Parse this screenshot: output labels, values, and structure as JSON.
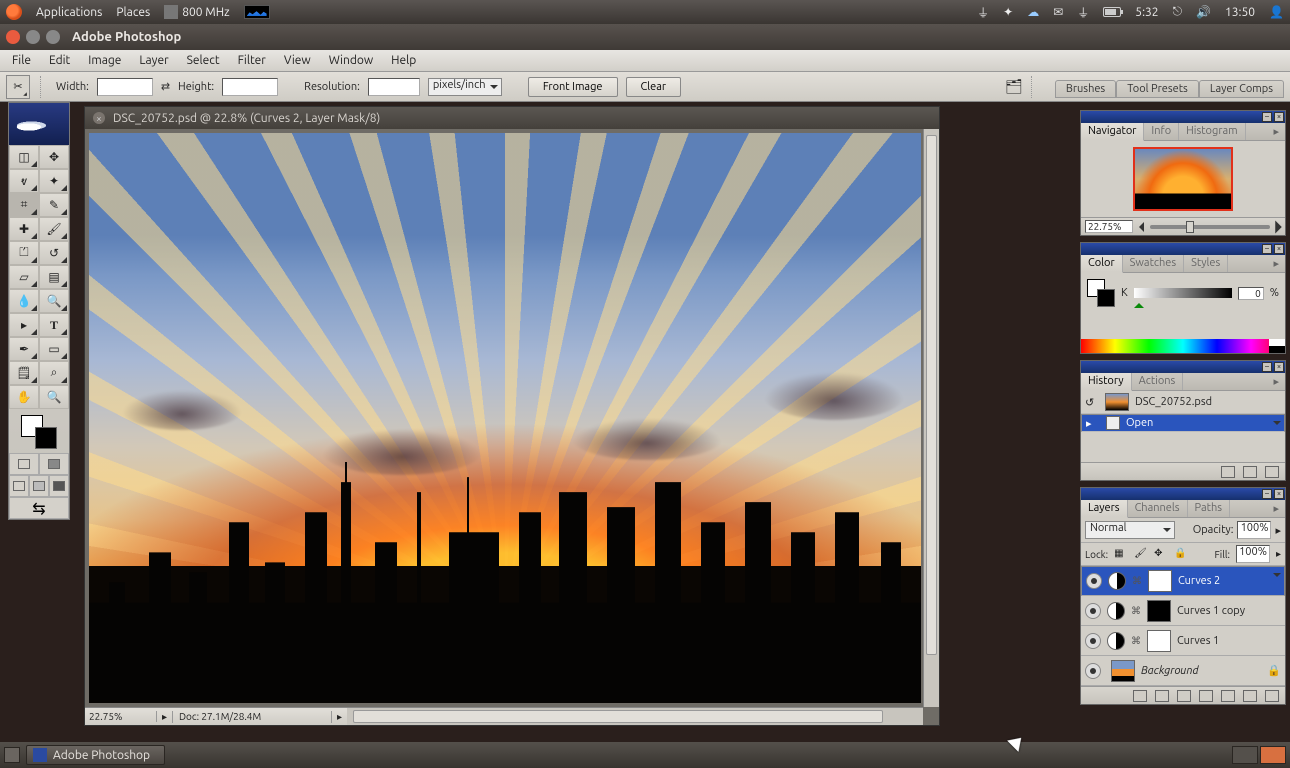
{
  "ubuntu_panel": {
    "applications": "Applications",
    "places": "Places",
    "cpu_freq": "800 MHz",
    "battery_time": "5:32",
    "clock": "13:50"
  },
  "window": {
    "title": "Adobe Photoshop"
  },
  "menu": [
    "File",
    "Edit",
    "Image",
    "Layer",
    "Select",
    "Filter",
    "View",
    "Window",
    "Help"
  ],
  "options_bar": {
    "width_label": "Width:",
    "width_value": "",
    "height_label": "Height:",
    "height_value": "",
    "resolution_label": "Resolution:",
    "resolution_value": "",
    "resolution_unit": "pixels/inch",
    "front_image_btn": "Front Image",
    "clear_btn": "Clear",
    "right_tabs": [
      "Brushes",
      "Tool Presets",
      "Layer Comps"
    ]
  },
  "document": {
    "title": "DSC_20752.psd @ 22.8% (Curves 2, Layer Mask/8)",
    "status_zoom": "22.75%",
    "status_doc": "Doc: 27.1M/28.4M"
  },
  "navigator": {
    "tabs": [
      "Navigator",
      "Info",
      "Histogram"
    ],
    "zoom": "22.75%"
  },
  "color": {
    "tabs": [
      "Color",
      "Swatches",
      "Styles"
    ],
    "channel": "K",
    "value": "0",
    "pct": "%"
  },
  "history": {
    "tabs": [
      "History",
      "Actions"
    ],
    "doc_name": "DSC_20752.psd",
    "step": "Open"
  },
  "layers": {
    "tabs": [
      "Layers",
      "Channels",
      "Paths"
    ],
    "blend_mode": "Normal",
    "opacity_label": "Opacity:",
    "opacity_value": "100%",
    "lock_label": "Lock:",
    "fill_label": "Fill:",
    "fill_value": "100%",
    "rows": [
      {
        "name": "Curves 2",
        "sel": true,
        "thumb": "white",
        "adj": true
      },
      {
        "name": "Curves 1 copy",
        "sel": false,
        "thumb": "black",
        "adj": true
      },
      {
        "name": "Curves 1",
        "sel": false,
        "thumb": "white",
        "adj": true
      },
      {
        "name": "Background",
        "sel": false,
        "thumb": "img",
        "adj": false,
        "locked": true
      }
    ]
  },
  "taskbar": {
    "app": "Adobe Photoshop"
  }
}
